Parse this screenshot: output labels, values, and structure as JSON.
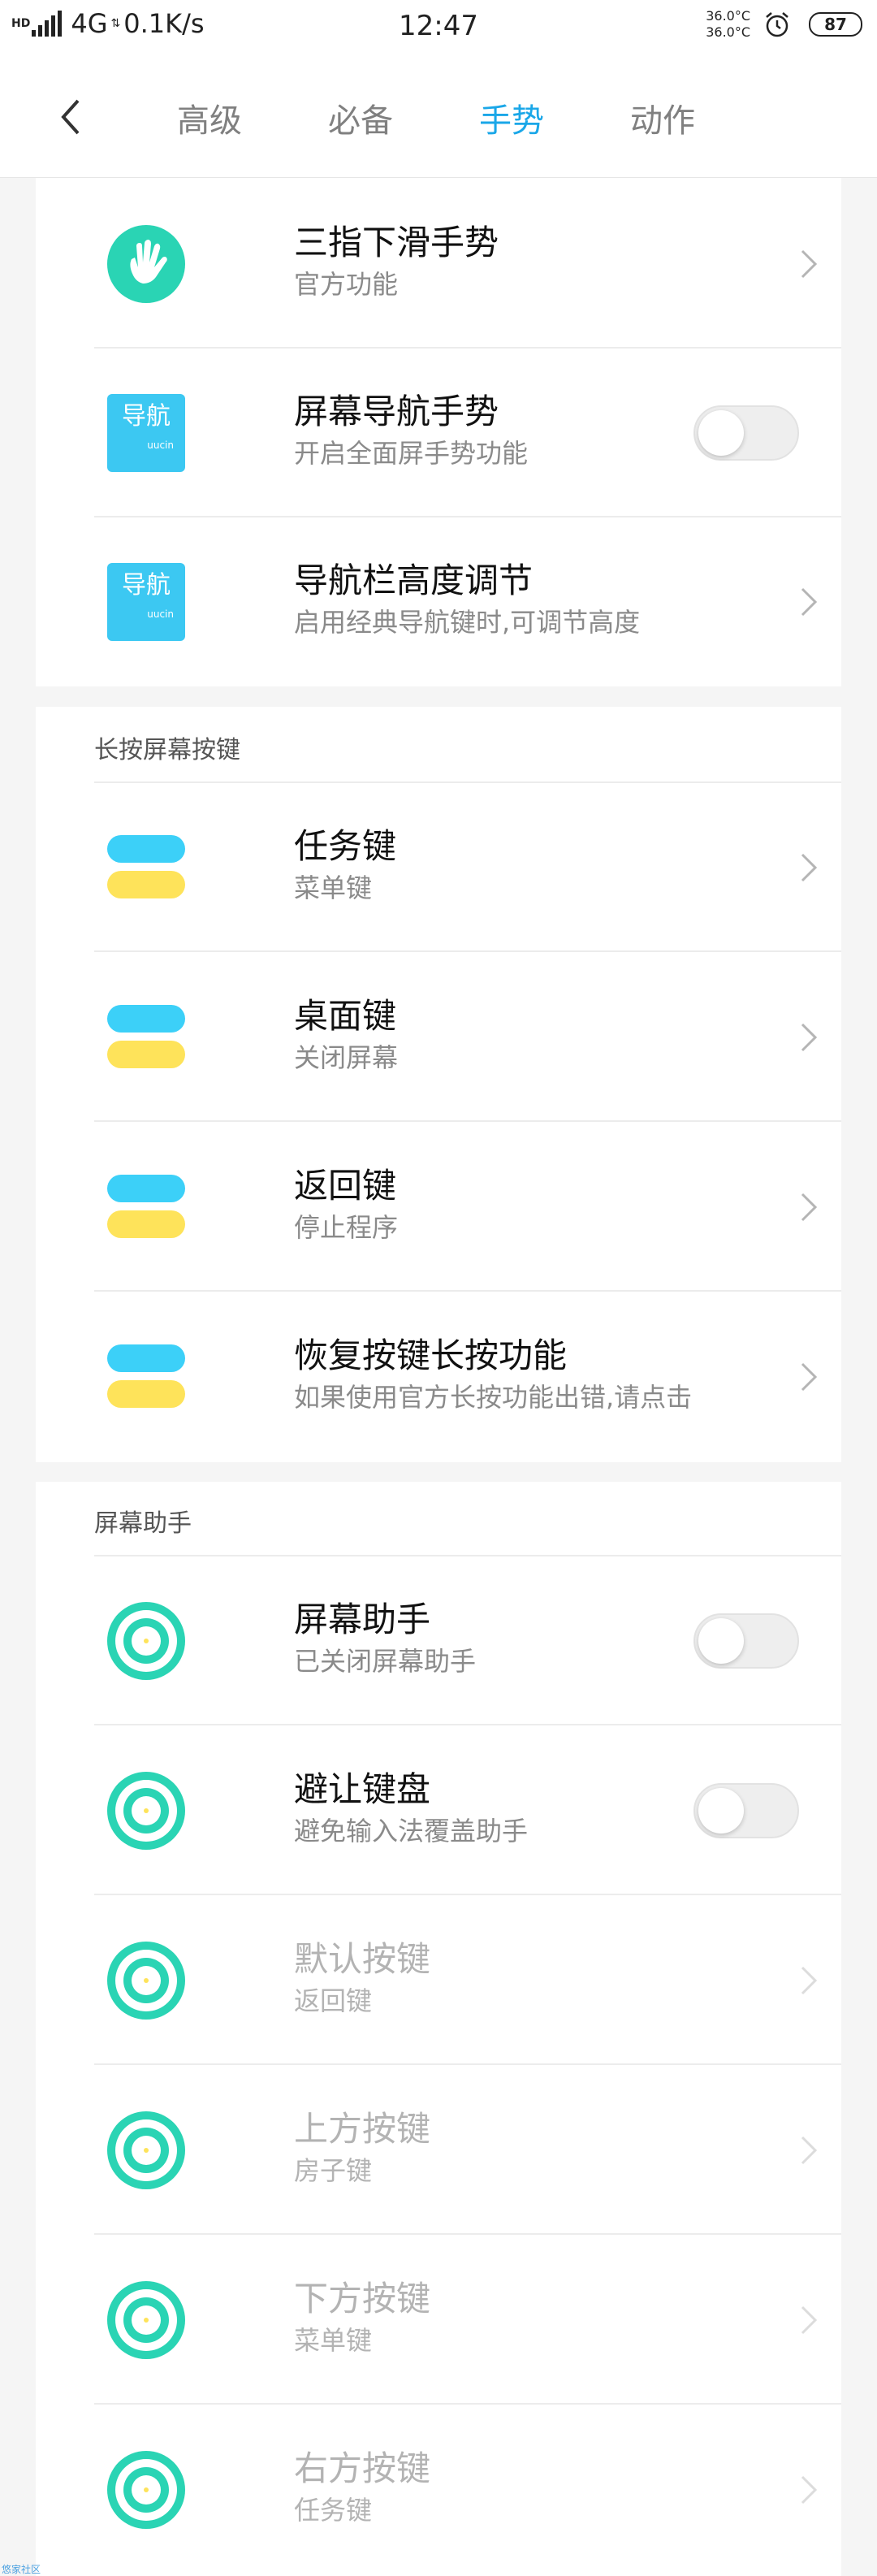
{
  "status_bar": {
    "hd": "HD",
    "network": "4G",
    "speed": "0.1K/s",
    "time": "12:47",
    "temp_top": "36.0°C",
    "temp_bottom": "36.0°C",
    "battery": "87",
    "alarm_icon": "alarm-clock-icon"
  },
  "header": {
    "back_icon": "back-arrow-icon",
    "tabs": [
      {
        "label": "高级",
        "active": false
      },
      {
        "label": "必备",
        "active": false
      },
      {
        "label": "手势",
        "active": true
      },
      {
        "label": "动作",
        "active": false
      }
    ],
    "active_color": "#1aa7e8"
  },
  "gesture_section": {
    "items": [
      {
        "title": "三指下滑手势",
        "subtitle": "官方功能",
        "icon": "hand-icon",
        "control": "chevron"
      },
      {
        "title": "屏幕导航手势",
        "subtitle": "开启全面屏手势功能",
        "icon": "nav-icon",
        "icon_text": "导航",
        "icon_subtext": "uucin",
        "control": "toggle",
        "on": false
      },
      {
        "title": "导航栏高度调节",
        "subtitle": "启用经典导航键时,可调节高度",
        "icon": "nav-icon",
        "icon_text": "导航",
        "icon_subtext": "uucin",
        "control": "chevron"
      }
    ]
  },
  "long_press_section": {
    "title": "长按屏幕按键",
    "items": [
      {
        "title": "任务键",
        "subtitle": "菜单键",
        "icon": "key-icon",
        "control": "chevron"
      },
      {
        "title": "桌面键",
        "subtitle": "关闭屏幕",
        "icon": "key-icon",
        "control": "chevron"
      },
      {
        "title": "返回键",
        "subtitle": "停止程序",
        "icon": "key-icon",
        "control": "chevron"
      },
      {
        "title": "恢复按键长按功能",
        "subtitle": "如果使用官方长按功能出错,请点击",
        "icon": "key-icon",
        "control": "chevron"
      }
    ]
  },
  "assistant_section": {
    "title": "屏幕助手",
    "items": [
      {
        "title": "屏幕助手",
        "subtitle": "已关闭屏幕助手",
        "icon": "target-icon",
        "control": "toggle",
        "on": false,
        "disabled": false
      },
      {
        "title": "避让键盘",
        "subtitle": "避免输入法覆盖助手",
        "icon": "target-icon",
        "control": "toggle",
        "on": false,
        "disabled": false
      },
      {
        "title": "默认按键",
        "subtitle": "返回键",
        "icon": "target-icon",
        "control": "chevron",
        "disabled": true
      },
      {
        "title": "上方按键",
        "subtitle": "房子键",
        "icon": "target-icon",
        "control": "chevron",
        "disabled": true
      },
      {
        "title": "下方按键",
        "subtitle": "菜单键",
        "icon": "target-icon",
        "control": "chevron",
        "disabled": true
      },
      {
        "title": "右方按键",
        "subtitle": "任务键",
        "icon": "target-icon",
        "control": "chevron",
        "disabled": true
      }
    ]
  },
  "colors": {
    "teal": "#2ad4b4",
    "nav_blue": "#3cc8f2",
    "key_blue": "#3cd0f8",
    "key_yellow": "#fee35a"
  },
  "watermark": "悠家社区"
}
